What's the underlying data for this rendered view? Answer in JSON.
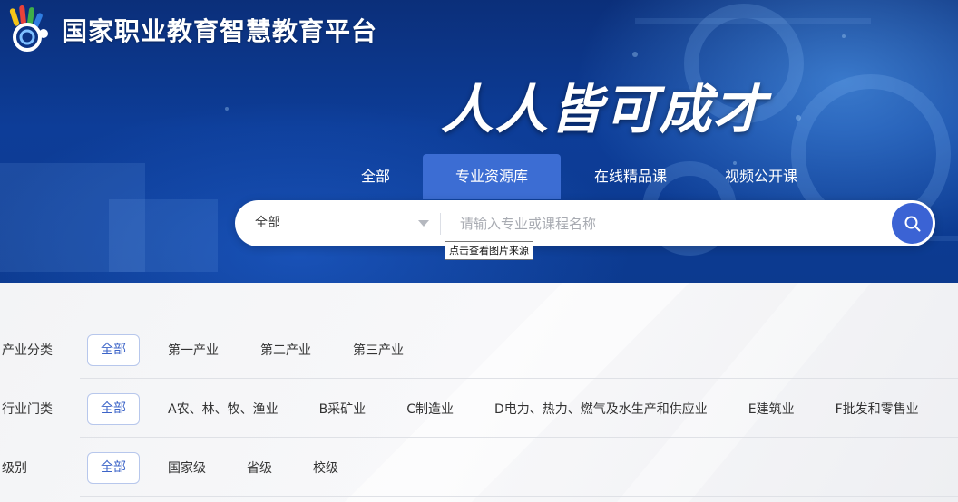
{
  "header": {
    "site_title": "国家职业教育智慧教育平台",
    "slogan": "人人皆可成才",
    "logo_icon": "colorful-hand-logo"
  },
  "tabs": [
    {
      "label": "全部",
      "active": false
    },
    {
      "label": "专业资源库",
      "active": true
    },
    {
      "label": "在线精品课",
      "active": false
    },
    {
      "label": "视频公开课",
      "active": false
    }
  ],
  "search": {
    "scope_value": "全部",
    "placeholder": "请输入专业或课程名称",
    "button_icon": "search-icon"
  },
  "tooltip": {
    "text": "点击查看图片来源"
  },
  "filters": [
    {
      "label": "产业分类",
      "options": [
        "全部",
        "第一产业",
        "第二产业",
        "第三产业"
      ],
      "selected": 0
    },
    {
      "label": "行业门类",
      "options": [
        "全部",
        "A农、林、牧、渔业",
        "B采矿业",
        "C制造业",
        "D电力、热力、燃气及水生产和供应业",
        "E建筑业",
        "F批发和零售业"
      ],
      "selected": 0
    },
    {
      "label": "级别",
      "options": [
        "全部",
        "国家级",
        "省级",
        "校级"
      ],
      "selected": 0
    }
  ],
  "colors": {
    "hero_bg": "#0c3a8f",
    "active_tab": "#3c6dd3",
    "search_button": "#3b63d4",
    "selected_option_text": "#3c64c8",
    "selected_option_border": "#b7c7ec"
  }
}
